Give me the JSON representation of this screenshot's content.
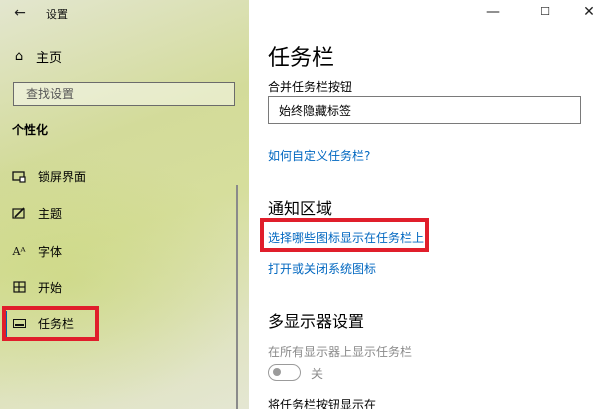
{
  "window": {
    "title": "设置",
    "back_icon": "←",
    "controls": {
      "minimize": "—",
      "maximize": "☐",
      "close": "✕"
    }
  },
  "sidebar": {
    "home_label": "主页",
    "search_placeholder": "查找设置",
    "section_title": "个性化",
    "items": [
      {
        "label": "锁屏界面",
        "icon": "lock-screen-icon"
      },
      {
        "label": "主题",
        "icon": "theme-brush-icon"
      },
      {
        "label": "字体",
        "icon": "font-icon"
      },
      {
        "label": "开始",
        "icon": "start-icon"
      },
      {
        "label": "任务栏",
        "icon": "taskbar-icon",
        "selected": true
      }
    ]
  },
  "main": {
    "title": "任务栏",
    "combine_label": "合并任务栏按钮",
    "combine_value": "始终隐藏标签",
    "customize_link": "如何自定义任务栏?",
    "notification_heading": "通知区域",
    "choose_icons_link": "选择哪些图标显示在任务栏上",
    "system_icons_link": "打开或关闭系统图标",
    "multi_display_heading": "多显示器设置",
    "show_on_all_label": "在所有显示器上显示任务栏",
    "toggle_state": "关",
    "show_buttons_on_label": "将任务栏按钮显示在"
  },
  "colors": {
    "accent": "#0063b1",
    "link": "#0067c0",
    "highlight_box": "#e01e2b"
  }
}
